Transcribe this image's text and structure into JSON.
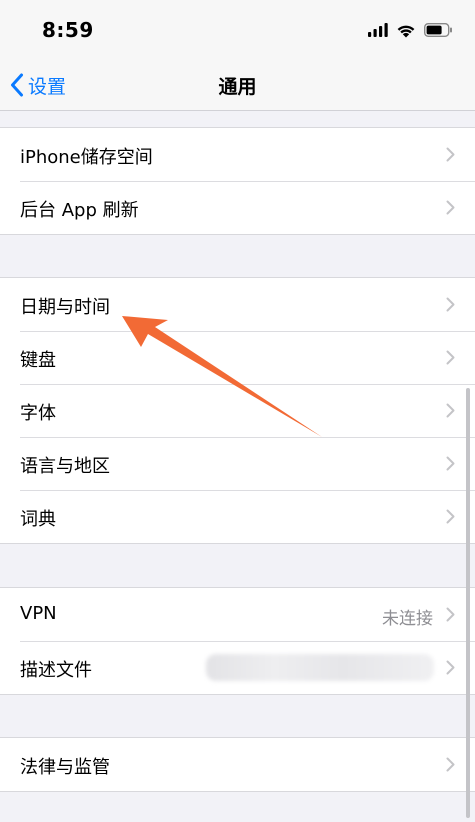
{
  "status_bar": {
    "time": "8:59",
    "icons": [
      "cellular-signal-icon",
      "wifi-icon",
      "battery-icon"
    ]
  },
  "nav": {
    "back_label": "设置",
    "title": "通用",
    "accent_color": "#0a7aff"
  },
  "groups": [
    {
      "items": [
        {
          "label": "iPhone储存空间"
        },
        {
          "label": "后台 App 刷新"
        }
      ]
    },
    {
      "items": [
        {
          "label": "日期与时间"
        },
        {
          "label": "键盘"
        },
        {
          "label": "字体"
        },
        {
          "label": "语言与地区"
        },
        {
          "label": "词典"
        }
      ]
    },
    {
      "items": [
        {
          "label": "VPN",
          "value": "未连接"
        },
        {
          "label": "描述文件"
        }
      ]
    },
    {
      "items": [
        {
          "label": "法律与监管"
        }
      ]
    }
  ],
  "annotation": {
    "color": "#f26a35",
    "icon": "arrow-annotation-icon"
  }
}
